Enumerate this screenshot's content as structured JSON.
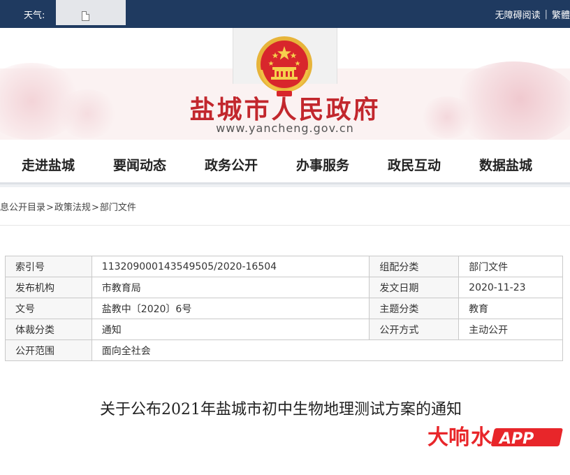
{
  "topbar": {
    "weather_label": "天气:",
    "accessibility_label": "无障碍阅读",
    "separator": "|",
    "traditional_label": "繁體"
  },
  "banner": {
    "site_title": "盐城市人民政府",
    "site_url": "www.yancheng.gov.cn",
    "emblem_icon": "national-emblem-icon"
  },
  "nav": {
    "items": [
      {
        "label": "走进盐城"
      },
      {
        "label": "要闻动态"
      },
      {
        "label": "政务公开"
      },
      {
        "label": "办事服务"
      },
      {
        "label": "政民互动"
      },
      {
        "label": "数据盐城"
      }
    ]
  },
  "breadcrumb": {
    "items": [
      "息公开目录",
      "政策法规",
      "部门文件"
    ],
    "separator": ">"
  },
  "info": {
    "rows": [
      [
        "索引号",
        "113209000143549505/2020-16504",
        "组配分类",
        "部门文件"
      ],
      [
        "发布机构",
        "市教育局",
        "发文日期",
        "2020-11-23"
      ],
      [
        "文号",
        "盐教中〔2020〕6号",
        "主题分类",
        "教育"
      ],
      [
        "体裁分类",
        "通知",
        "公开方式",
        "主动公开"
      ],
      [
        "公开范围",
        "面向全社会"
      ]
    ]
  },
  "document": {
    "title": "关于公布2021年盐城市初中生物地理测试方案的通知"
  },
  "watermark": {
    "brand": "大",
    "brand2": "响",
    "brand3": "水",
    "app": "APP",
    "color": "#e8262a"
  },
  "colors": {
    "topbar": "#1f3a60",
    "title_red": "#c2272d"
  }
}
